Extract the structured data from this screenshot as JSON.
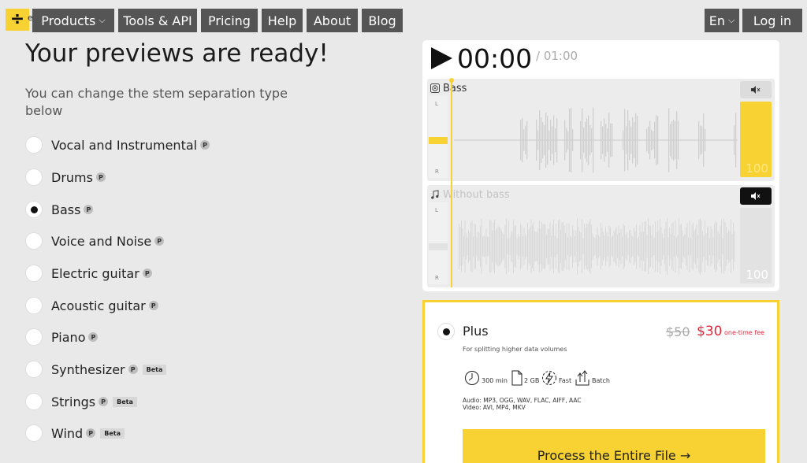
{
  "nav": {
    "logo_suffix": "e",
    "items": [
      {
        "label": "Products",
        "has_dropdown": true
      },
      {
        "label": "Tools & API"
      },
      {
        "label": "Pricing"
      },
      {
        "label": "Help"
      },
      {
        "label": "About"
      },
      {
        "label": "Blog"
      }
    ],
    "language": "En",
    "login": "Log in"
  },
  "main": {
    "title": "Your previews are ready!",
    "subtitle": "You can change the stem separation type below",
    "options": [
      {
        "label": "Vocal and Instrumental",
        "premium": true,
        "selected": false
      },
      {
        "label": "Drums",
        "premium": true,
        "selected": false
      },
      {
        "label": "Bass",
        "premium": true,
        "selected": true
      },
      {
        "label": "Voice and Noise",
        "premium": true,
        "selected": false
      },
      {
        "label": "Electric guitar",
        "premium": true,
        "selected": false
      },
      {
        "label": "Acoustic guitar",
        "premium": true,
        "selected": false
      },
      {
        "label": "Piano",
        "premium": true,
        "selected": false
      },
      {
        "label": "Synthesizer",
        "premium": true,
        "beta": "Beta",
        "selected": false
      },
      {
        "label": "Strings",
        "premium": true,
        "beta": "Beta",
        "selected": false
      },
      {
        "label": "Wind",
        "premium": true,
        "beta": "Beta",
        "selected": false
      }
    ],
    "premium_badge": "P"
  },
  "player": {
    "current_time": "00:00",
    "duration": "/ 01:00",
    "channel_left": "L",
    "channel_right": "R",
    "tracks": [
      {
        "label": "Bass",
        "volume": "100",
        "muted": false,
        "active": true
      },
      {
        "label": "Without bass",
        "volume": "100",
        "muted": true,
        "active": false
      }
    ]
  },
  "plan": {
    "name": "Plus",
    "description": "For splitting higher data volumes",
    "price_old": "$50",
    "price_new": "$30",
    "fee_note": "one-time fee",
    "features": [
      {
        "label": "300 min",
        "icon": "clock-icon"
      },
      {
        "label": "2 GB",
        "icon": "file-icon"
      },
      {
        "label": "Fast",
        "icon": "lightning-icon"
      },
      {
        "label": "Batch",
        "icon": "upload-batch-icon"
      }
    ],
    "formats_audio": "Audio: MP3, OGG, WAV, FLAC, AIFF, AAC",
    "formats_video": "Video: AVI, MP4, MKV",
    "cta": "Process the Entire File →"
  },
  "colors": {
    "accent": "#f7d232",
    "nav_bg": "#555555",
    "price_red": "#e0283c",
    "background": "#e9e9e9"
  }
}
